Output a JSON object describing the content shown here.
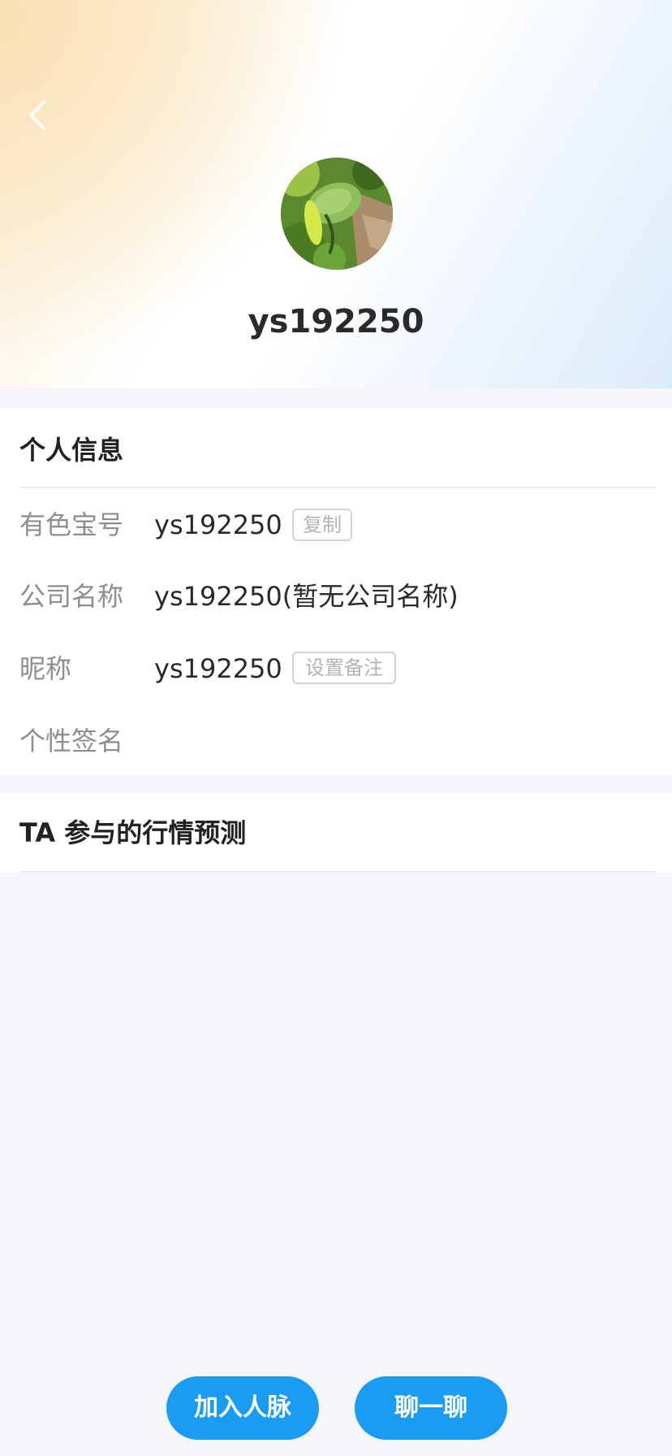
{
  "header": {
    "back_icon": "chevron-left-icon",
    "avatar_alt": "user avatar",
    "username": "ys192250"
  },
  "personal_info": {
    "title": "个人信息",
    "rows": [
      {
        "label": "有色宝号",
        "value": "ys192250",
        "action": "复制"
      },
      {
        "label": "公司名称",
        "value": "ys192250(暂无公司名称)"
      },
      {
        "label": "昵称",
        "value": "ys192250",
        "action": "设置备注"
      },
      {
        "label": "个性签名",
        "value": ""
      }
    ]
  },
  "forecast": {
    "title": "TA 参与的行情预测"
  },
  "actions": {
    "add_contact": "加入人脉",
    "chat": "聊一聊"
  },
  "colors": {
    "accent": "#1a9cf2",
    "label_gray": "#8e8e8e",
    "tag_border": "#d3d3d3",
    "background": "#f4f6f9"
  }
}
